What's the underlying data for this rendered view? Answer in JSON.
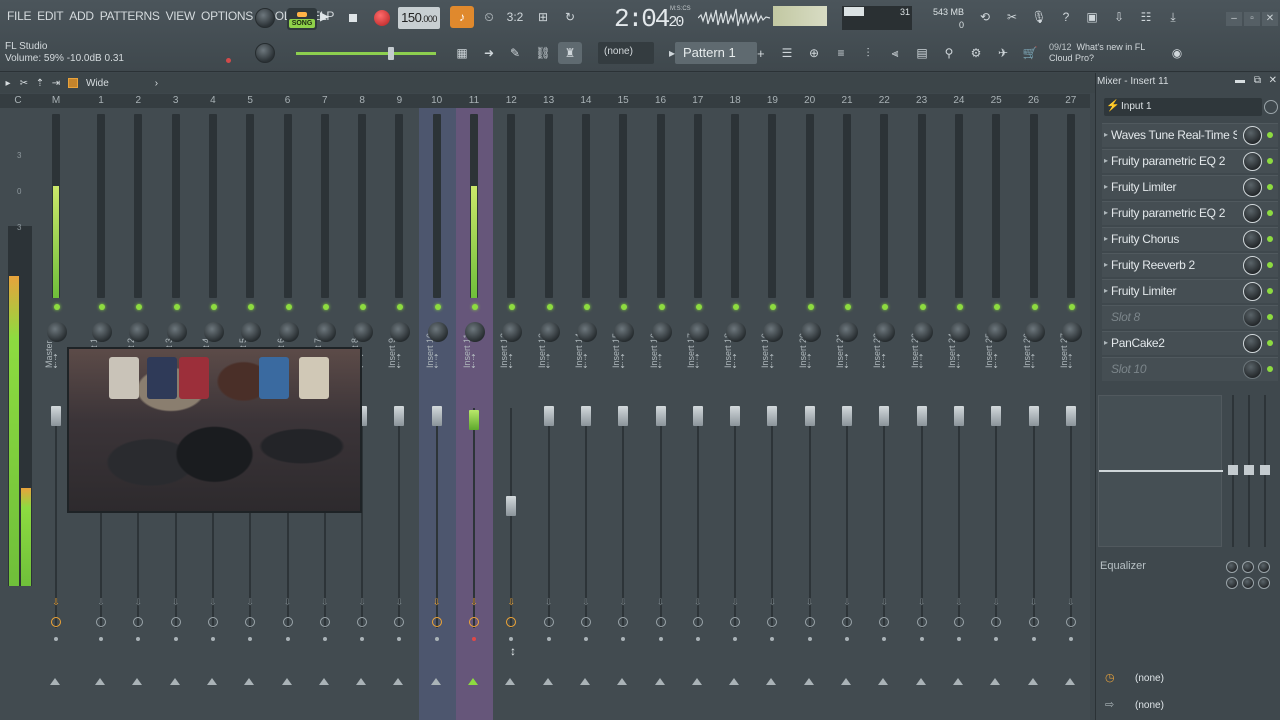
{
  "menu": [
    "FILE",
    "EDIT",
    "ADD",
    "PATTERNS",
    "VIEW",
    "OPTIONS",
    "TOOLS",
    "HELP"
  ],
  "hint": {
    "app": "FL Studio",
    "detail": "Volume: 59%  -10.0dB  0.31"
  },
  "transport": {
    "mode_label": "SONG",
    "tempo_main": "150",
    "tempo_decimal": ".000",
    "time_main": "2:04",
    "time_sub": "20",
    "time_unit": "M:S:CS"
  },
  "perf": {
    "cpu_value": "31",
    "memory": "543 MB",
    "poly": "0"
  },
  "pattern": {
    "selector": "(none)",
    "name": "Pattern 1",
    "add": "+"
  },
  "news": {
    "counter": "09/12",
    "headline": "What's new in FL",
    "line2": "Cloud Pro?"
  },
  "mixer_toolbar": {
    "view_label": "Wide",
    "collapse_arrow": "›"
  },
  "ruler": [
    "C",
    "M",
    "1",
    "2",
    "3",
    "4",
    "5",
    "6",
    "7",
    "8",
    "9",
    "10",
    "11",
    "12",
    "13",
    "14",
    "15",
    "16",
    "17",
    "18",
    "19",
    "20",
    "21",
    "22",
    "23",
    "24",
    "25",
    "26",
    "27"
  ],
  "master_scale": [
    "3",
    "0",
    "3"
  ],
  "tracks": [
    {
      "name": "Master",
      "level": 0.75
    },
    {
      "name": "Insert 1",
      "level": 0
    },
    {
      "name": "Insert 2",
      "level": 0
    },
    {
      "name": "Insert 3",
      "level": 0
    },
    {
      "name": "Insert 4",
      "level": 0
    },
    {
      "name": "Insert 5",
      "level": 0
    },
    {
      "name": "Insert 6",
      "level": 0
    },
    {
      "name": "Insert 7",
      "level": 0
    },
    {
      "name": "Insert 8",
      "level": 0
    },
    {
      "name": "Insert 9",
      "level": 0
    },
    {
      "name": "Insert 10",
      "level": 0
    },
    {
      "name": "Insert 11",
      "level": 0.75
    },
    {
      "name": "Insert 12",
      "level": 0
    },
    {
      "name": "Insert 13",
      "level": 0
    },
    {
      "name": "Insert 14",
      "level": 0
    },
    {
      "name": "Insert 15",
      "level": 0
    },
    {
      "name": "Insert 16",
      "level": 0
    },
    {
      "name": "Insert 17",
      "level": 0
    },
    {
      "name": "Insert 18",
      "level": 0
    },
    {
      "name": "Insert 19",
      "level": 0
    },
    {
      "name": "Insert 20",
      "level": 0
    },
    {
      "name": "Insert 21",
      "level": 0
    },
    {
      "name": "Insert 22",
      "level": 0
    },
    {
      "name": "Insert 23",
      "level": 0
    },
    {
      "name": "Insert 24",
      "level": 0
    },
    {
      "name": "Insert 25",
      "level": 0
    },
    {
      "name": "Insert 26",
      "level": 0
    },
    {
      "name": "Insert 27",
      "level": 0
    }
  ],
  "insert_panel": {
    "title": "Mixer - Insert 11",
    "input": "Input 1",
    "slots": [
      {
        "label": "Waves Tune Real-Time S...",
        "empty": false
      },
      {
        "label": "Fruity parametric EQ 2",
        "empty": false
      },
      {
        "label": "Fruity Limiter",
        "empty": false
      },
      {
        "label": "Fruity parametric EQ 2",
        "empty": false
      },
      {
        "label": "Fruity Chorus",
        "empty": false
      },
      {
        "label": "Fruity Reeverb 2",
        "empty": false
      },
      {
        "label": "Fruity Limiter",
        "empty": false
      },
      {
        "label": "Slot 8",
        "empty": true
      },
      {
        "label": "PanCake2",
        "empty": false
      },
      {
        "label": "Slot 10",
        "empty": true
      }
    ],
    "eq_label": "Equalizer",
    "output_top": "(none)",
    "output_bottom": "(none)"
  },
  "colors": {
    "accent_green": "#8ddb40",
    "accent_orange": "#e8a33c",
    "selected_track": "#aa6ec8"
  }
}
